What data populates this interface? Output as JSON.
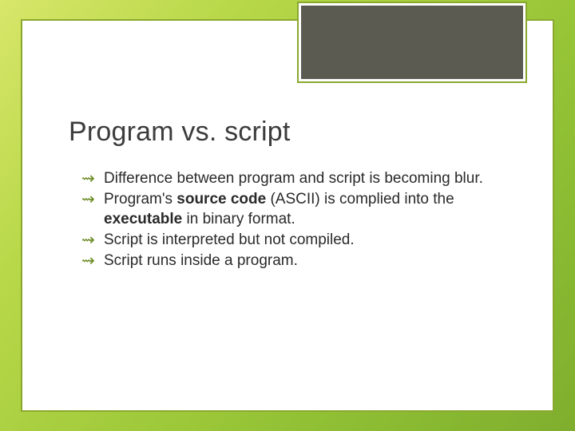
{
  "slide": {
    "title": "Program vs. script",
    "bullets": [
      {
        "html": "Difference between program and script is becoming blur."
      },
      {
        "html": "Program's <b>source code</b> (ASCII) is complied into the <b>executable</b> in binary format."
      },
      {
        "html": "Script is interpreted but not compiled."
      },
      {
        "html": "Script runs inside a program."
      }
    ]
  }
}
